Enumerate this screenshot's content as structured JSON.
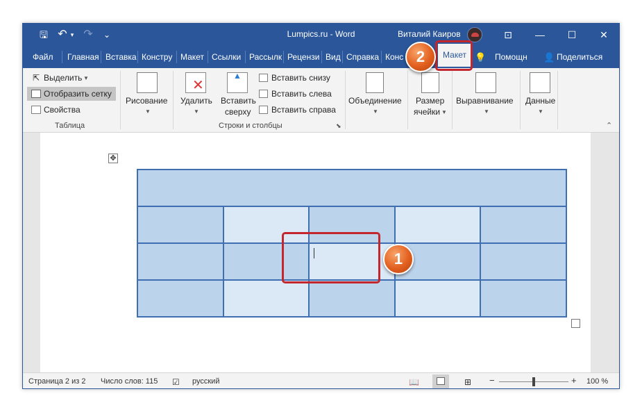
{
  "titlebar": {
    "title": "Lumpics.ru  -  Word",
    "user": "Виталий Каиров",
    "qa_icons": [
      "save-icon",
      "undo-icon",
      "redo-icon",
      "customize-icon"
    ],
    "qa_glyphs": {
      "save": "🖫",
      "undo": "↶",
      "undo_menu": "▾",
      "redo": "↷",
      "customize": "⌄"
    },
    "controls": {
      "ribbon_options": "⊡",
      "minimize": "—",
      "maximize": "☐",
      "close": "✕"
    }
  },
  "tabs": [
    {
      "label": "Файл"
    },
    {
      "label": "Главная"
    },
    {
      "label": "Вставка"
    },
    {
      "label": "Констру"
    },
    {
      "label": "Макет"
    },
    {
      "label": "Ссылки"
    },
    {
      "label": "Рассылк"
    },
    {
      "label": "Рецензи"
    },
    {
      "label": "Вид"
    },
    {
      "label": "Справка"
    },
    {
      "label": "Конс"
    }
  ],
  "active_tab": "Макет",
  "tell_me": {
    "glyph": "💡",
    "label": "Помощн"
  },
  "share": {
    "glyph": "👤",
    "label": "Поделиться"
  },
  "ribbon": {
    "table_group": {
      "select": "Выделить",
      "gridlines": "Отобразить сетку",
      "properties": "Свойства",
      "label": "Таблица"
    },
    "draw": "Рисование",
    "delete": "Удалить",
    "insert_above": [
      "Вставить",
      "сверху"
    ],
    "insert_below": "Вставить снизу",
    "insert_left": "Вставить слева",
    "insert_right": "Вставить справа",
    "rows_cols_label": "Строки и столбцы",
    "merge": "Объединение",
    "cell_size": [
      "Размер",
      "ячейки"
    ],
    "alignment": "Выравнивание",
    "data": "Данные"
  },
  "status": {
    "page": "Страница 2 из 2",
    "words": "Число слов: 115",
    "language": "русский",
    "zoom": "100 %",
    "zoom_minus": "−",
    "zoom_plus": "+",
    "zoom_level": 1.0
  },
  "callouts": {
    "one": "1",
    "two": "2"
  },
  "table": {
    "header_row": "merged",
    "rows": [
      [
        "dark",
        "light",
        "dark",
        "light",
        "dark"
      ],
      [
        "dark",
        "dark",
        "active",
        "dark",
        "dark"
      ],
      [
        "dark",
        "light",
        "dark",
        "light",
        "dark"
      ]
    ]
  },
  "colors": {
    "accent": "#2b579a",
    "callout_frame": "#c4262e",
    "callout_fill": "#e2601f",
    "cell_dark": "#bcd3ec",
    "cell_light": "#dbe8f5",
    "table_border": "#3f6fb0"
  }
}
